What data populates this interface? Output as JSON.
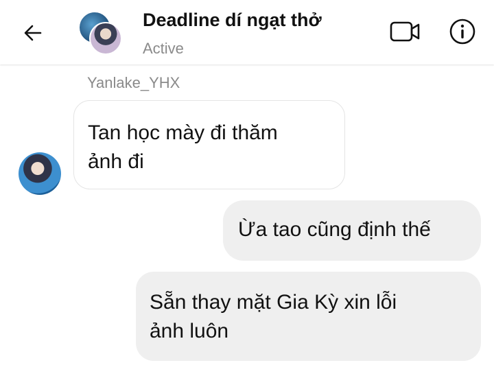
{
  "header": {
    "title": "Deadline dí ngạt thở",
    "status": "Active",
    "icons": {
      "back": "back-arrow-icon",
      "video": "video-call-icon",
      "info": "info-icon"
    }
  },
  "messages": {
    "incoming": {
      "sender": "Yanlake_YHX",
      "text": "Tan học mày đi thăm\nảnh đi"
    },
    "outgoing": [
      {
        "text": "Ừa tao cũng định thế"
      },
      {
        "text": "Sẵn thay mặt Gia Kỳ xin lỗi\nảnh luôn"
      }
    ]
  },
  "colors": {
    "outgoing_bubble": "#efefef",
    "incoming_border": "#e4e4e4",
    "muted_text": "#8a8a8a"
  }
}
